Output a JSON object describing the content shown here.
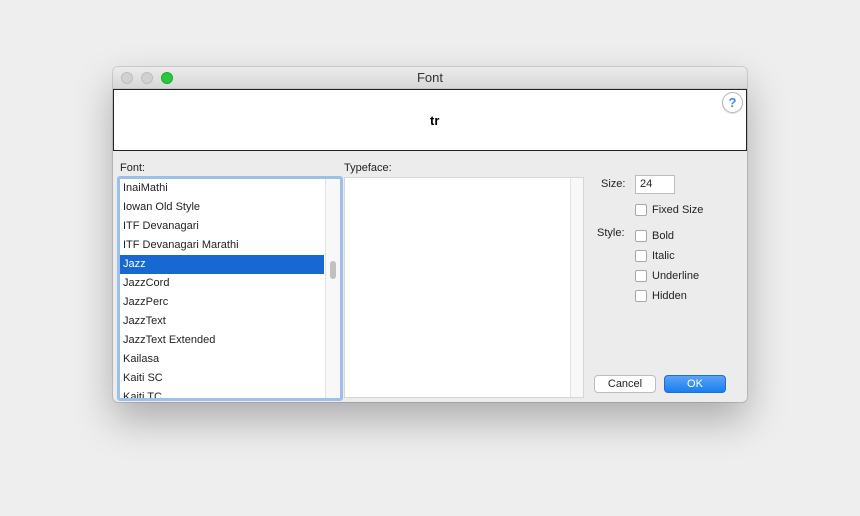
{
  "window": {
    "title": "Font"
  },
  "preview": {
    "sample_text": "tr",
    "help_label": "?"
  },
  "labels": {
    "font": "Font:",
    "typeface": "Typeface:",
    "size": "Size:",
    "style": "Style:"
  },
  "font_list": {
    "items": [
      "InaiMathi",
      "Iowan Old Style",
      "ITF Devanagari",
      "ITF Devanagari Marathi",
      "Jazz",
      "JazzCord",
      "JazzPerc",
      "JazzText",
      "JazzText Extended",
      "Kailasa",
      "Kaiti SC",
      "Kaiti TC"
    ],
    "selected": "Jazz"
  },
  "size": {
    "value": "24"
  },
  "options": {
    "fixed_size": "Fixed Size",
    "bold": "Bold",
    "italic": "Italic",
    "underline": "Underline",
    "hidden": "Hidden"
  },
  "buttons": {
    "cancel": "Cancel",
    "ok": "OK"
  },
  "colors": {
    "selection": "#1868d3",
    "accent": "#1a7ef0",
    "zoom_light": "#28c940"
  }
}
